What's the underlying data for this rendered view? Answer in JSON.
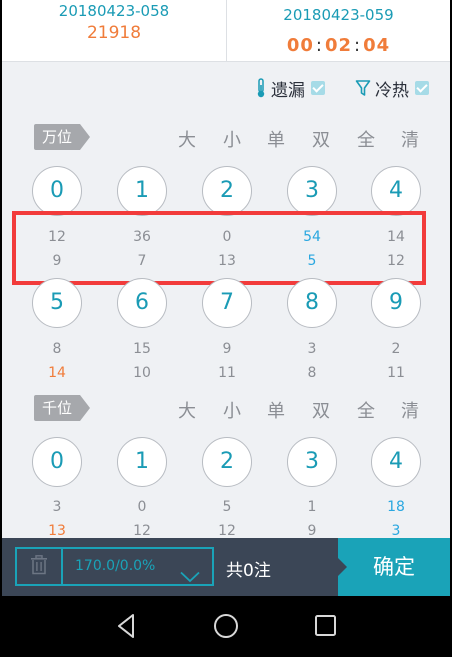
{
  "header": {
    "prev_issue": "20180423-058",
    "prev_number": "21918",
    "current_issue": "20180423-059",
    "countdown": {
      "hh": "00",
      "mm": "02",
      "ss": "04",
      "sep": ":"
    }
  },
  "toggles": {
    "missing_label": "遗漏",
    "hotcold_label": "冷热"
  },
  "filters": [
    "大",
    "小",
    "单",
    "双",
    "全",
    "清"
  ],
  "sections": [
    {
      "label": "万位",
      "balls": [
        {
          "num": "0",
          "miss": "12",
          "hot": "9"
        },
        {
          "num": "1",
          "miss": "36",
          "hot": "7"
        },
        {
          "num": "2",
          "miss": "0",
          "hot": "13"
        },
        {
          "num": "3",
          "miss": "54",
          "hot": "5"
        },
        {
          "num": "4",
          "miss": "14",
          "hot": "12"
        },
        {
          "num": "5",
          "miss": "8",
          "hot": "14"
        },
        {
          "num": "6",
          "miss": "15",
          "hot": "10"
        },
        {
          "num": "7",
          "miss": "9",
          "hot": "11"
        },
        {
          "num": "8",
          "miss": "3",
          "hot": "8"
        },
        {
          "num": "9",
          "miss": "2",
          "hot": "11"
        }
      ]
    },
    {
      "label": "千位",
      "balls": [
        {
          "num": "0",
          "miss": "3",
          "hot": "13"
        },
        {
          "num": "1",
          "miss": "0",
          "hot": "12"
        },
        {
          "num": "2",
          "miss": "5",
          "hot": "12"
        },
        {
          "num": "3",
          "miss": "1",
          "hot": "9"
        },
        {
          "num": "4",
          "miss": "18",
          "hot": "3"
        }
      ]
    }
  ],
  "bottom_bar": {
    "odds_value": "170.0/0.0%",
    "total": "共0注",
    "confirm": "确定"
  },
  "colors": {
    "accent": "#1aa3b8",
    "orange": "#f07c3a",
    "highlight_blue": "#2aa7e0",
    "annotation_red": "#f23b3b"
  },
  "icons": {
    "missing": "thermometer-icon",
    "hotcold": "funnel-icon",
    "trash": "trash-icon",
    "chevron": "chevron-down-icon",
    "nav": [
      "back-triangle-icon",
      "home-circle-icon",
      "recents-square-icon"
    ]
  }
}
